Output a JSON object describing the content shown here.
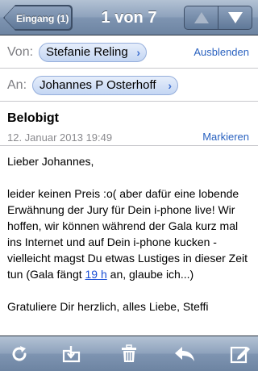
{
  "navbar": {
    "back_label": "Eingang (1)",
    "title": "1 von 7"
  },
  "header": {
    "from_label": "Von:",
    "from_name": "Stefanie Reling",
    "hide_label": "Ausblenden",
    "to_label": "An:",
    "to_name": "Johannes P Osterhoff"
  },
  "message": {
    "subject": "Belobigt",
    "date": "12. Januar 2013 19:49",
    "mark_label": "Markieren",
    "greeting": "Lieber Johannes,",
    "body_before_link": "leider keinen Preis :o( aber dafür eine lobende Erwähnung der Jury für Dein i-phone live! Wir hoffen, wir können während der Gala kurz mal ins Internet und auf Dein i-phone kucken - vielleicht magst Du etwas Lustiges in dieser Zeit tun (Gala fängt ",
    "body_link": "19 h",
    "body_after_link": " an, glaube ich...)",
    "closing": "Gratuliere Dir herzlich, alles Liebe, Steffi"
  },
  "toolbar": {
    "icons": [
      "refresh-icon",
      "move-to-folder-icon",
      "trash-icon",
      "reply-icon",
      "compose-icon"
    ]
  },
  "colors": {
    "nav_bar": "#8fa3bd",
    "link": "#2a62c0",
    "chip": "#c4d6f3"
  }
}
